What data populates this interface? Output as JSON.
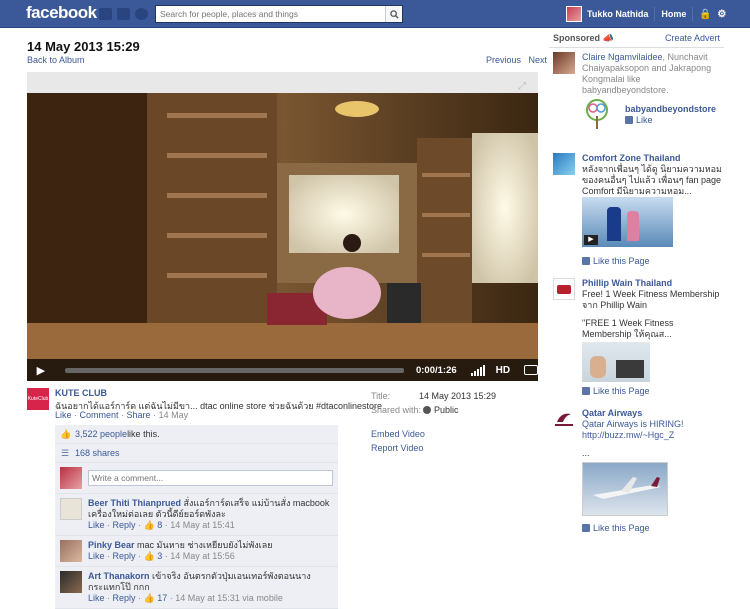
{
  "topbar": {
    "logo": "facebook",
    "search_placeholder": "Search for people, places and things",
    "user_name": "Tukko Nathida",
    "home_label": "Home"
  },
  "page": {
    "title": "14 May 2013 15:29",
    "back_link": "Back to Album",
    "previous": "Previous",
    "next": "Next"
  },
  "video": {
    "time": "0:00/1:26",
    "hd_label": "HD"
  },
  "post": {
    "author": "KUTE CLUB",
    "avatar_text": "KuteClub",
    "message": "ฉันอยากได้แอร์การ์ด แต่ฉันไม่มีขา... dtac online store ช่วยฉันด้วย #dtaconlinestore",
    "like": "Like",
    "comment": "Comment",
    "share": "Share",
    "date": "14 May"
  },
  "meta": {
    "title_label": "Title:",
    "title_value": "14 May 2013 15:29",
    "shared_label": "Shared with:",
    "shared_value": "Public",
    "embed": "Embed Video",
    "report": "Report Video"
  },
  "ufi": {
    "likes_count": "3,522 people",
    "likes_suffix": " like this.",
    "shares": "168 shares",
    "comment_placeholder": "Write a comment...",
    "comments": [
      {
        "name": "Beer Thiti Thianprued",
        "text": " สั่งแอร์การ์ดเสร็จ แม่บ้านสั่ง macbook เครื่องใหม่ต่อเลย ตัวนี้ดีย์ยอร์ดพังละ",
        "like": "Like",
        "reply": "Reply",
        "count": "8",
        "time": "14 May at 15:41"
      },
      {
        "name": "Pinky Bear",
        "text": " mac มันหาย ช่างเหยียบยังไม่พังเลย",
        "like": "Like",
        "reply": "Reply",
        "count": "3",
        "time": "14 May at 15:56"
      },
      {
        "name": "Art Thanakorn",
        "text": " เข้าจริง อันตรกตัวปุ่มเอนเทอร์พังตอนนางกระแทกโป๊ กกก",
        "like": "Like",
        "reply": "Reply",
        "count": "17",
        "time": "14 May at 15:31 via mobile"
      }
    ]
  },
  "sidebar": {
    "sponsored": "Sponsored",
    "create_advert": "Create Advert",
    "ads": [
      {
        "line1a": "Claire Ngamvilaidee",
        "line1b": ", Nunchavit Chaiyapaksopon and Jakrapong Kongmalai like babyandbeyondstore.",
        "brand": "babyandbeyondstore",
        "like": "Like"
      },
      {
        "title": "Comfort Zone Thailand",
        "body": "หลังจากเพื่อนๆ ได้ดู นิยามความหอม ของคนอื่นๆ ไปแล้ว เพื่อนๆ fan page Comfort มีนิยามความหอม...",
        "like": "Like this Page"
      },
      {
        "title": "Phillip Wain Thailand",
        "body": "Free! 1 Week Fitness Membership จาก Phillip Wain",
        "quote": "\"FREE 1 Week Fitness Membership ให้คุณส...",
        "like": "Like this Page"
      },
      {
        "title": "Qatar Airways",
        "body": "Qatar Airways is HIRING! http://buzz.mw/~Hgc_Z",
        "dots": "...",
        "like": "Like this Page"
      }
    ]
  }
}
